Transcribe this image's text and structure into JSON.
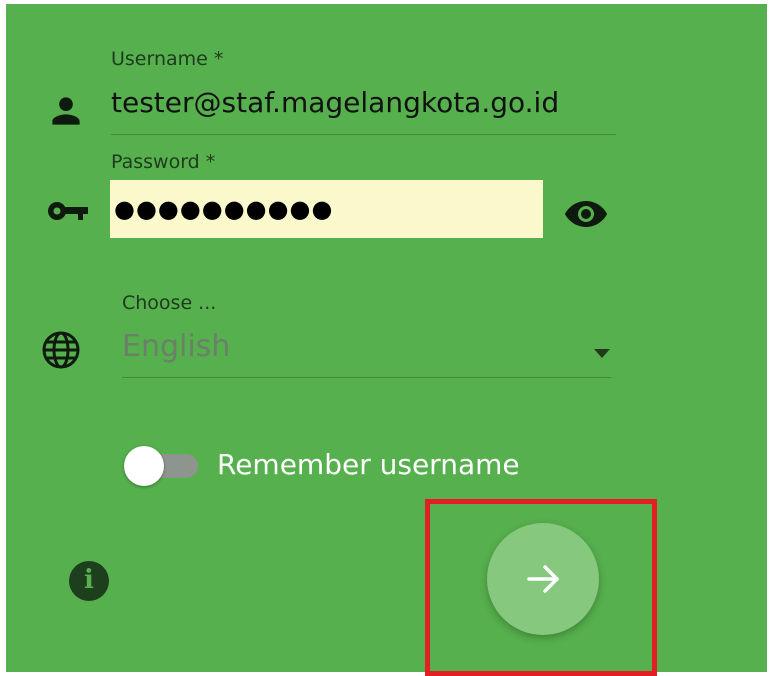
{
  "login": {
    "username": {
      "label": "Username *",
      "value": "tester@staf.magelangkota.go.id"
    },
    "password": {
      "label": "Password *",
      "masked_value": "●●●●●●●●●●"
    },
    "language": {
      "label": "Choose ...",
      "selected": "English"
    },
    "remember": {
      "label": "Remember username",
      "checked": false
    }
  },
  "icons": {
    "user": "person-icon",
    "password": "key-icon",
    "visibility": "eye-icon",
    "language": "globe-icon",
    "dropdown": "chevron-down-icon",
    "info": "info-icon",
    "submit": "arrow-right-icon"
  },
  "colors": {
    "panel": "#56b04d",
    "password_fill": "#fbf8cb",
    "submit_button": "#86c87e",
    "highlight": "#e31e24"
  }
}
